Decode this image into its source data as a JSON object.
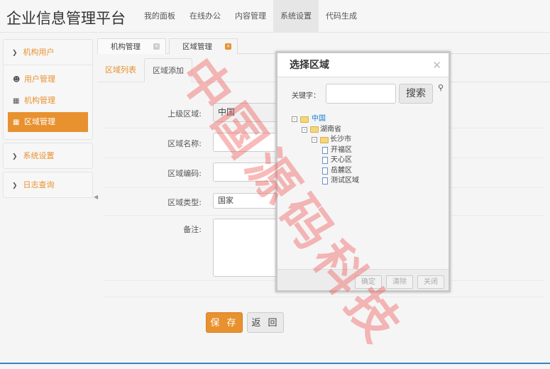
{
  "header": {
    "brand": "企业信息管理平台",
    "nav": [
      "我的面板",
      "在线办公",
      "内容管理",
      "系统设置",
      "代码生成"
    ]
  },
  "sidebar": {
    "group1": "机构用户",
    "items": [
      "用户管理",
      "机构管理",
      "区域管理"
    ],
    "group2": "系统设置",
    "group3": "日志查询"
  },
  "tabs": [
    "机构管理",
    "区域管理"
  ],
  "subtabs": [
    "区域列表",
    "区域添加"
  ],
  "form": {
    "parent_label": "上级区域:",
    "parent_value": "中国",
    "name_label": "区域名称:",
    "code_label": "区域编码:",
    "type_label": "区域类型:",
    "type_value": "国家",
    "remark_label": "备注:",
    "save": "保 存",
    "back": "返 回"
  },
  "dialog": {
    "title": "选择区域",
    "keyword_label": "关键字：",
    "search": "搜索",
    "tree": {
      "root": "中国",
      "province": "湖南省",
      "city": "长沙市",
      "districts": [
        "开福区",
        "天心区",
        "岳麓区",
        "测试区域"
      ]
    },
    "ok": "确定",
    "clear": "清除",
    "close": "关闭"
  },
  "watermark": "中国源码科技",
  "colors": {
    "accent": "#e8912f",
    "bottom_bar": "#3b82c4"
  }
}
